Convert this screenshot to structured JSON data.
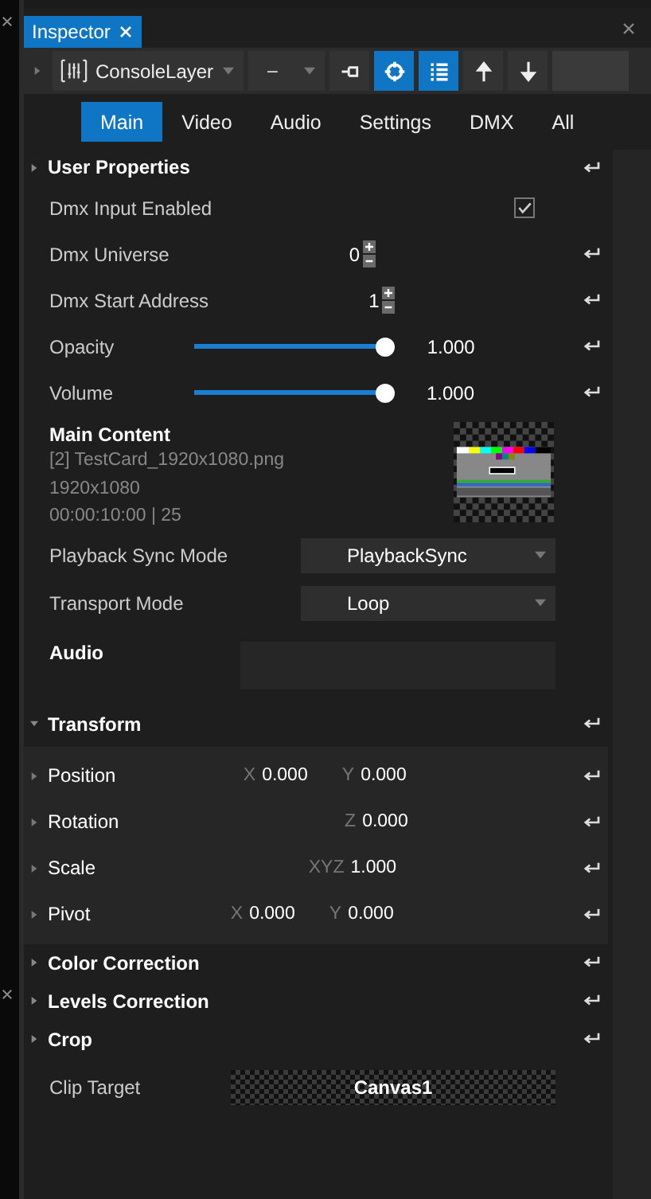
{
  "panel_tab": {
    "title": "Inspector"
  },
  "toolbar": {
    "layer_name": "ConsoleLayer",
    "dropdown_value": "–",
    "buttons": [
      {
        "kind": "pin",
        "selected": false
      },
      {
        "kind": "target",
        "selected": true
      },
      {
        "kind": "list",
        "selected": true
      },
      {
        "kind": "up",
        "selected": false
      },
      {
        "kind": "down",
        "selected": false
      }
    ]
  },
  "tabs": [
    {
      "label": "Main",
      "selected": true
    },
    {
      "label": "Video",
      "selected": false
    },
    {
      "label": "Audio",
      "selected": false
    },
    {
      "label": "Settings",
      "selected": false
    },
    {
      "label": "DMX",
      "selected": false
    },
    {
      "label": "All",
      "selected": false
    }
  ],
  "user_properties": {
    "title": "User Properties",
    "expanded": false,
    "rows": [
      {
        "kind": "checkbox",
        "label": "Dmx Input Enabled",
        "checked": true
      },
      {
        "kind": "stepper",
        "label": "Dmx Universe",
        "value": "0"
      },
      {
        "kind": "stepper",
        "label": "Dmx Start Address",
        "value": "1"
      },
      {
        "kind": "slider",
        "label": "Opacity",
        "level": 1,
        "reading": "1.000"
      },
      {
        "kind": "slider",
        "label": "Volume",
        "level": 1,
        "reading": "1.000"
      }
    ]
  },
  "main_content": {
    "title": "Main Content",
    "file": "[2] TestCard_1920x1080.png",
    "resolution": "1920x1080",
    "duration": "00:00:10:00 | 25",
    "dropdowns": [
      {
        "label": "Playback Sync Mode",
        "value": "PlaybackSync"
      },
      {
        "label": "Transport Mode",
        "value": "Loop"
      }
    ]
  },
  "audio": {
    "title": "Audio"
  },
  "transform": {
    "title": "Transform",
    "expanded": true,
    "rows": [
      {
        "label": "Position",
        "fields": [
          {
            "axis": "X",
            "value": "0.000"
          },
          {
            "axis": "Y",
            "value": "0.000"
          }
        ]
      },
      {
        "label": "Rotation",
        "fields": [
          {
            "axis": "Z",
            "value": "0.000"
          }
        ]
      },
      {
        "label": "Scale",
        "fields": [
          {
            "axis": "XYZ",
            "value": "1.000"
          }
        ]
      },
      {
        "label": "Pivot",
        "fields": [
          {
            "axis": "X",
            "value": "0.000"
          },
          {
            "axis": "Y",
            "value": "0.000"
          }
        ]
      }
    ]
  },
  "sections": [
    {
      "title": "Color Correction",
      "expanded": false
    },
    {
      "title": "Levels Correction",
      "expanded": false
    },
    {
      "title": "Crop",
      "expanded": false
    }
  ],
  "clip_target": {
    "label": "Clip Target",
    "value": "Canvas1"
  }
}
